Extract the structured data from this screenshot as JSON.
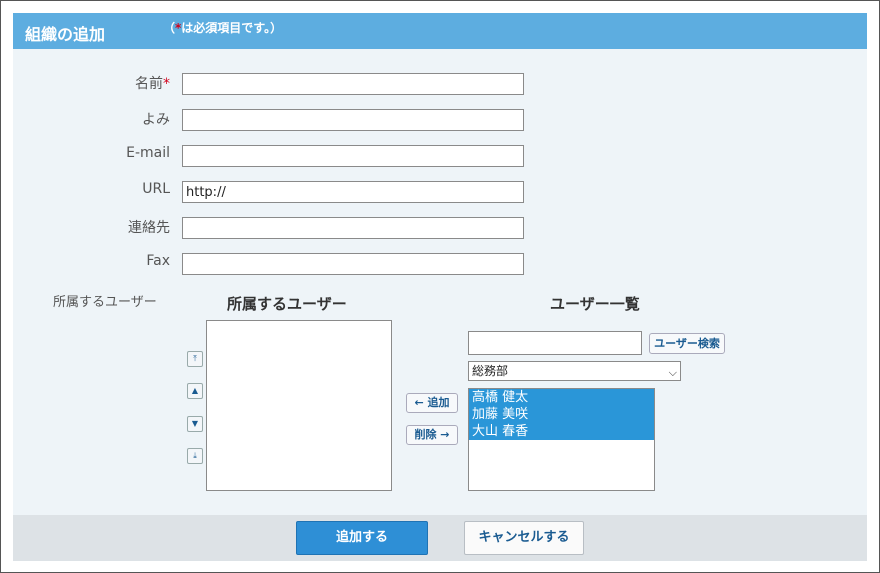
{
  "header": {
    "title": "組織の追加",
    "note_prefix": "（",
    "note_star": "*",
    "note_suffix": "は必須項目です。）"
  },
  "form": {
    "fields": [
      {
        "label": "名前",
        "required": true,
        "value": ""
      },
      {
        "label": "よみ",
        "required": false,
        "value": ""
      },
      {
        "label": "E-mail",
        "required": false,
        "value": ""
      },
      {
        "label": "URL",
        "required": false,
        "value": "http://"
      },
      {
        "label": "連絡先",
        "required": false,
        "value": ""
      },
      {
        "label": "Fax",
        "required": false,
        "value": ""
      }
    ],
    "required_mark": "*"
  },
  "members": {
    "label": "所属するユーザー",
    "selected_title": "所属するユーザー",
    "list_title": "ユーザー一覧",
    "move_top_icon": "⤒",
    "move_up_icon": "▲",
    "move_down_icon": "▼",
    "move_bottom_icon": "⤓",
    "add_label": "← 追加",
    "remove_label": "削除 →",
    "search_value": "",
    "search_button": "ユーザー検索",
    "group_selected": "総務部",
    "users": [
      "高橋 健太",
      "加藤 美咲",
      "大山 春香"
    ]
  },
  "footer": {
    "submit_label": "追加する",
    "cancel_label": "キャンセルする"
  },
  "colors": {
    "header_bg": "#5dade0",
    "panel_bg": "#eef4f8",
    "selected_item": "#2a96d8",
    "primary": "#2e8fd6",
    "required": "#d0021b"
  }
}
